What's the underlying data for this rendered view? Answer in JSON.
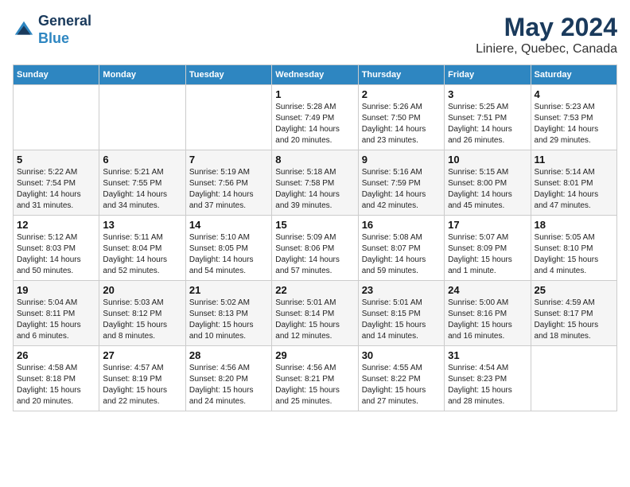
{
  "header": {
    "logo_line1": "General",
    "logo_line2": "Blue",
    "title": "May 2024",
    "subtitle": "Liniere, Quebec, Canada"
  },
  "weekdays": [
    "Sunday",
    "Monday",
    "Tuesday",
    "Wednesday",
    "Thursday",
    "Friday",
    "Saturday"
  ],
  "weeks": [
    [
      {
        "day": "",
        "sunrise": "",
        "sunset": "",
        "daylight": ""
      },
      {
        "day": "",
        "sunrise": "",
        "sunset": "",
        "daylight": ""
      },
      {
        "day": "",
        "sunrise": "",
        "sunset": "",
        "daylight": ""
      },
      {
        "day": "1",
        "sunrise": "Sunrise: 5:28 AM",
        "sunset": "Sunset: 7:49 PM",
        "daylight": "Daylight: 14 hours and 20 minutes."
      },
      {
        "day": "2",
        "sunrise": "Sunrise: 5:26 AM",
        "sunset": "Sunset: 7:50 PM",
        "daylight": "Daylight: 14 hours and 23 minutes."
      },
      {
        "day": "3",
        "sunrise": "Sunrise: 5:25 AM",
        "sunset": "Sunset: 7:51 PM",
        "daylight": "Daylight: 14 hours and 26 minutes."
      },
      {
        "day": "4",
        "sunrise": "Sunrise: 5:23 AM",
        "sunset": "Sunset: 7:53 PM",
        "daylight": "Daylight: 14 hours and 29 minutes."
      }
    ],
    [
      {
        "day": "5",
        "sunrise": "Sunrise: 5:22 AM",
        "sunset": "Sunset: 7:54 PM",
        "daylight": "Daylight: 14 hours and 31 minutes."
      },
      {
        "day": "6",
        "sunrise": "Sunrise: 5:21 AM",
        "sunset": "Sunset: 7:55 PM",
        "daylight": "Daylight: 14 hours and 34 minutes."
      },
      {
        "day": "7",
        "sunrise": "Sunrise: 5:19 AM",
        "sunset": "Sunset: 7:56 PM",
        "daylight": "Daylight: 14 hours and 37 minutes."
      },
      {
        "day": "8",
        "sunrise": "Sunrise: 5:18 AM",
        "sunset": "Sunset: 7:58 PM",
        "daylight": "Daylight: 14 hours and 39 minutes."
      },
      {
        "day": "9",
        "sunrise": "Sunrise: 5:16 AM",
        "sunset": "Sunset: 7:59 PM",
        "daylight": "Daylight: 14 hours and 42 minutes."
      },
      {
        "day": "10",
        "sunrise": "Sunrise: 5:15 AM",
        "sunset": "Sunset: 8:00 PM",
        "daylight": "Daylight: 14 hours and 45 minutes."
      },
      {
        "day": "11",
        "sunrise": "Sunrise: 5:14 AM",
        "sunset": "Sunset: 8:01 PM",
        "daylight": "Daylight: 14 hours and 47 minutes."
      }
    ],
    [
      {
        "day": "12",
        "sunrise": "Sunrise: 5:12 AM",
        "sunset": "Sunset: 8:03 PM",
        "daylight": "Daylight: 14 hours and 50 minutes."
      },
      {
        "day": "13",
        "sunrise": "Sunrise: 5:11 AM",
        "sunset": "Sunset: 8:04 PM",
        "daylight": "Daylight: 14 hours and 52 minutes."
      },
      {
        "day": "14",
        "sunrise": "Sunrise: 5:10 AM",
        "sunset": "Sunset: 8:05 PM",
        "daylight": "Daylight: 14 hours and 54 minutes."
      },
      {
        "day": "15",
        "sunrise": "Sunrise: 5:09 AM",
        "sunset": "Sunset: 8:06 PM",
        "daylight": "Daylight: 14 hours and 57 minutes."
      },
      {
        "day": "16",
        "sunrise": "Sunrise: 5:08 AM",
        "sunset": "Sunset: 8:07 PM",
        "daylight": "Daylight: 14 hours and 59 minutes."
      },
      {
        "day": "17",
        "sunrise": "Sunrise: 5:07 AM",
        "sunset": "Sunset: 8:09 PM",
        "daylight": "Daylight: 15 hours and 1 minute."
      },
      {
        "day": "18",
        "sunrise": "Sunrise: 5:05 AM",
        "sunset": "Sunset: 8:10 PM",
        "daylight": "Daylight: 15 hours and 4 minutes."
      }
    ],
    [
      {
        "day": "19",
        "sunrise": "Sunrise: 5:04 AM",
        "sunset": "Sunset: 8:11 PM",
        "daylight": "Daylight: 15 hours and 6 minutes."
      },
      {
        "day": "20",
        "sunrise": "Sunrise: 5:03 AM",
        "sunset": "Sunset: 8:12 PM",
        "daylight": "Daylight: 15 hours and 8 minutes."
      },
      {
        "day": "21",
        "sunrise": "Sunrise: 5:02 AM",
        "sunset": "Sunset: 8:13 PM",
        "daylight": "Daylight: 15 hours and 10 minutes."
      },
      {
        "day": "22",
        "sunrise": "Sunrise: 5:01 AM",
        "sunset": "Sunset: 8:14 PM",
        "daylight": "Daylight: 15 hours and 12 minutes."
      },
      {
        "day": "23",
        "sunrise": "Sunrise: 5:01 AM",
        "sunset": "Sunset: 8:15 PM",
        "daylight": "Daylight: 15 hours and 14 minutes."
      },
      {
        "day": "24",
        "sunrise": "Sunrise: 5:00 AM",
        "sunset": "Sunset: 8:16 PM",
        "daylight": "Daylight: 15 hours and 16 minutes."
      },
      {
        "day": "25",
        "sunrise": "Sunrise: 4:59 AM",
        "sunset": "Sunset: 8:17 PM",
        "daylight": "Daylight: 15 hours and 18 minutes."
      }
    ],
    [
      {
        "day": "26",
        "sunrise": "Sunrise: 4:58 AM",
        "sunset": "Sunset: 8:18 PM",
        "daylight": "Daylight: 15 hours and 20 minutes."
      },
      {
        "day": "27",
        "sunrise": "Sunrise: 4:57 AM",
        "sunset": "Sunset: 8:19 PM",
        "daylight": "Daylight: 15 hours and 22 minutes."
      },
      {
        "day": "28",
        "sunrise": "Sunrise: 4:56 AM",
        "sunset": "Sunset: 8:20 PM",
        "daylight": "Daylight: 15 hours and 24 minutes."
      },
      {
        "day": "29",
        "sunrise": "Sunrise: 4:56 AM",
        "sunset": "Sunset: 8:21 PM",
        "daylight": "Daylight: 15 hours and 25 minutes."
      },
      {
        "day": "30",
        "sunrise": "Sunrise: 4:55 AM",
        "sunset": "Sunset: 8:22 PM",
        "daylight": "Daylight: 15 hours and 27 minutes."
      },
      {
        "day": "31",
        "sunrise": "Sunrise: 4:54 AM",
        "sunset": "Sunset: 8:23 PM",
        "daylight": "Daylight: 15 hours and 28 minutes."
      },
      {
        "day": "",
        "sunrise": "",
        "sunset": "",
        "daylight": ""
      }
    ]
  ]
}
